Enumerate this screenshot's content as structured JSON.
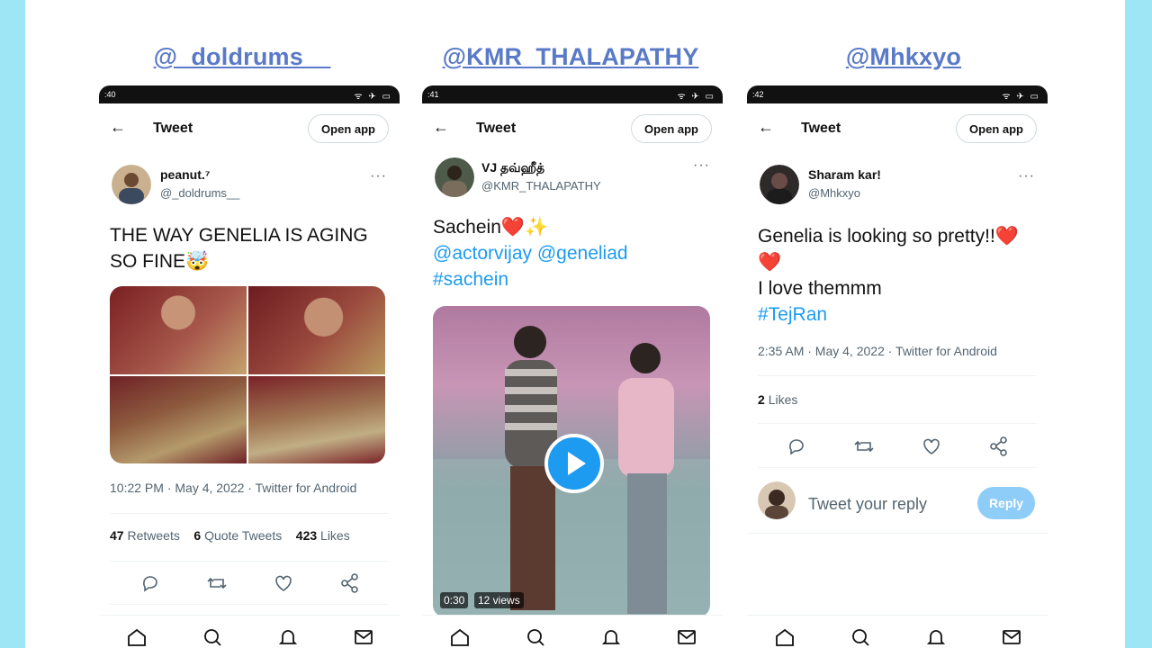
{
  "columns": [
    {
      "handle": "@_doldrums__",
      "status_time": ":40",
      "topbar": {
        "back": "←",
        "title": "Tweet",
        "open_app": "Open app"
      },
      "author": {
        "name": "peanut.⁷",
        "username": "@_doldrums__"
      },
      "text": "THE WAY GENELIA IS AGING SO FINE🤯",
      "meta": "10:22 PM · May 4, 2022 · Twitter for Android",
      "stats": {
        "retweets_count": "47",
        "retweets_label": "Retweets",
        "quotes_count": "6",
        "quotes_label": "Quote Tweets",
        "likes_count": "423",
        "likes_label": "Likes"
      }
    },
    {
      "handle": "@KMR_THALAPATHY",
      "status_time": ":41",
      "topbar": {
        "back": "←",
        "title": "Tweet",
        "open_app": "Open app"
      },
      "author": {
        "name": "VJ தவ்ஹீத்",
        "username": "@KMR_THALAPATHY"
      },
      "text_line1": "Sachein❤️✨",
      "text_line2": "@actorvijay @geneliad",
      "text_line3": "#sachein",
      "video": {
        "duration": "0:30",
        "views": "12 views"
      }
    },
    {
      "handle": "@Mhkxyo",
      "status_time": ":42",
      "topbar": {
        "back": "←",
        "title": "Tweet",
        "open_app": "Open app"
      },
      "author": {
        "name": "Sharam kar!",
        "username": "@Mhkxyo"
      },
      "text_line1": "Genelia is looking so pretty!!❤️",
      "text_line2": "❤️",
      "text_line3": "I love themmm",
      "text_line4": "#TejRan",
      "meta": "2:35 AM · May 4, 2022 · Twitter for Android",
      "stats": {
        "likes_count": "2",
        "likes_label": "Likes"
      },
      "reply": {
        "placeholder": "Tweet your reply",
        "button": "Reply"
      }
    }
  ],
  "more_glyph": "···",
  "statusbar_icons": "ᯤ ✈ ▭",
  "icons": [
    "reply-icon",
    "retweet-icon",
    "like-icon",
    "share-icon",
    "home-icon",
    "search-icon",
    "notifications-icon",
    "messages-icon"
  ],
  "colors": {
    "background": "#9ee6f5",
    "link": "#1d9bf0",
    "handle": "#5a79c7",
    "reply_button": "#8ecdf8"
  }
}
